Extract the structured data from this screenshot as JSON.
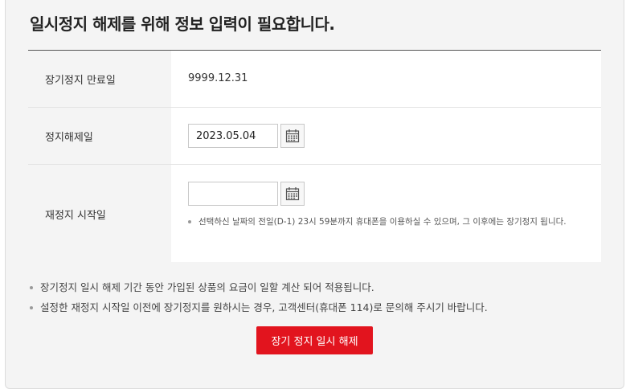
{
  "page": {
    "title": "일시정지 해제를 위해 정보 입력이 필요합니다."
  },
  "form": {
    "expiry": {
      "label": "장기정지 만료일",
      "value": "9999.12.31"
    },
    "release": {
      "label": "정지해제일",
      "value": "2023.05.04",
      "calendar_icon": "calendar-icon"
    },
    "resuspend": {
      "label": "재정지 시작일",
      "value": "",
      "calendar_icon": "calendar-icon",
      "hint": "선택하신 날짜의 전일(D-1) 23시 59분까지 휴대폰을 이용하실 수 있으며, 그 이후에는 장기정지 됩니다."
    }
  },
  "notes": [
    "장기정지 일시 해제 기간 동안 가입된 상품의 요금이 일할 계산 되어 적용됩니다.",
    "설정한 재정지 시작일 이전에 장기정지를 원하시는 경우, 고객센터(휴대폰 114)로 문의해 주시기 바랍니다."
  ],
  "actions": {
    "submit_label": "장기 정지 일시 해제"
  },
  "colors": {
    "accent": "#e2141e",
    "panel_background": "#f4f4f4",
    "table_top_border": "#555555"
  }
}
